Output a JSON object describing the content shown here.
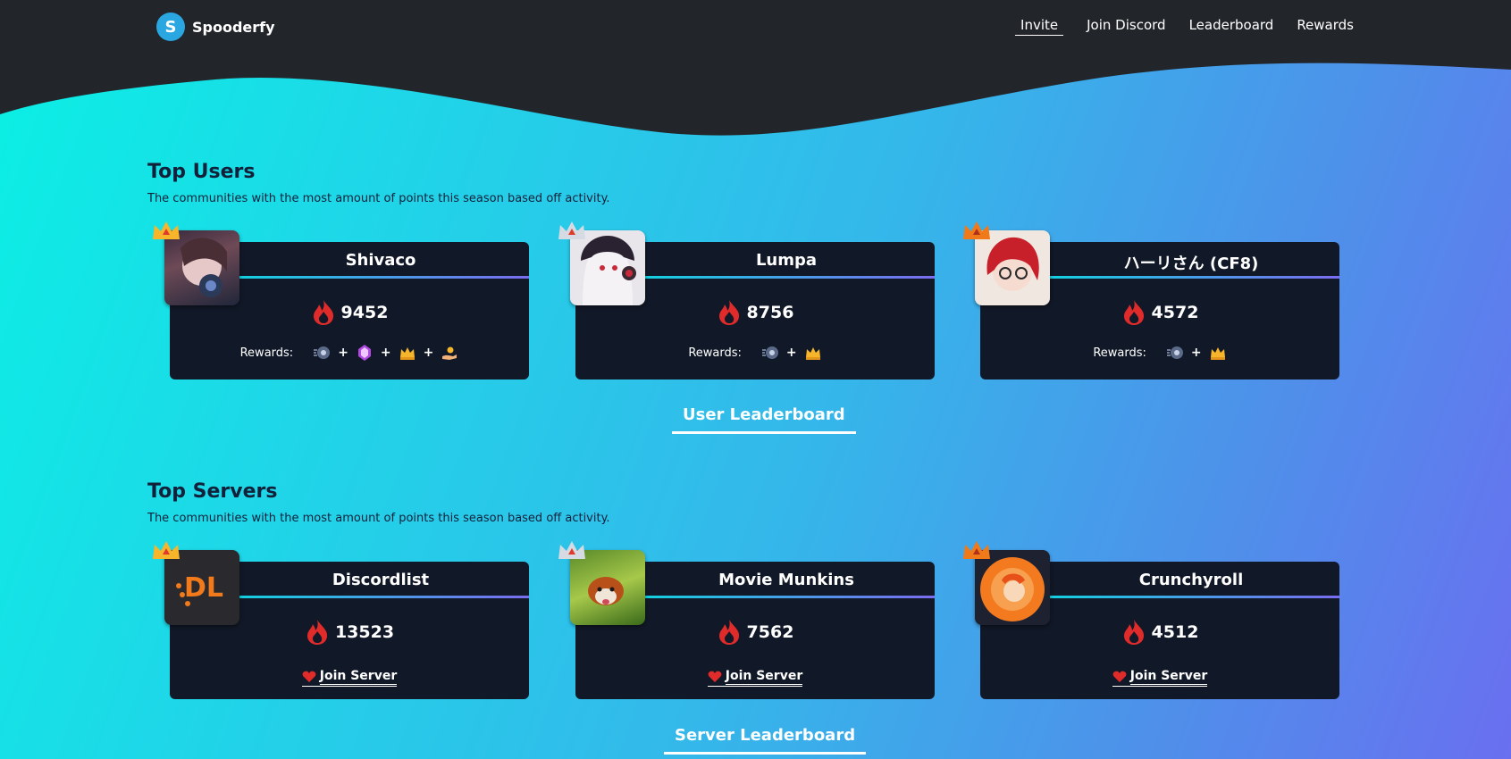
{
  "brand": {
    "name": "Spooderfy"
  },
  "nav": {
    "invite": "Invite",
    "discord": "Join Discord",
    "leaderboard": "Leaderboard",
    "rewards": "Rewards"
  },
  "top_users": {
    "title": "Top Users",
    "subtitle": "The communities with the most amount of points this season based off activity.",
    "rewards_label": "Rewards:",
    "items": [
      {
        "name": "Shivaco",
        "points": "9452"
      },
      {
        "name": "Lumpa",
        "points": "8756"
      },
      {
        "name": "ハーリさん (CF8)",
        "points": "4572"
      }
    ],
    "button": "User Leaderboard"
  },
  "top_servers": {
    "title": "Top Servers",
    "subtitle": "The communities with the most amount of points this season based off activity.",
    "join_label": "Join Server",
    "items": [
      {
        "name": "Discordlist",
        "points": "13523"
      },
      {
        "name": "Movie Munkins",
        "points": "7562"
      },
      {
        "name": "Crunchyroll",
        "points": "4512"
      }
    ],
    "button": "Server Leaderboard"
  },
  "colors": {
    "dark": "#111827",
    "header": "#22262b",
    "accent": "#14d0e0",
    "flame": "#e02b2b"
  }
}
